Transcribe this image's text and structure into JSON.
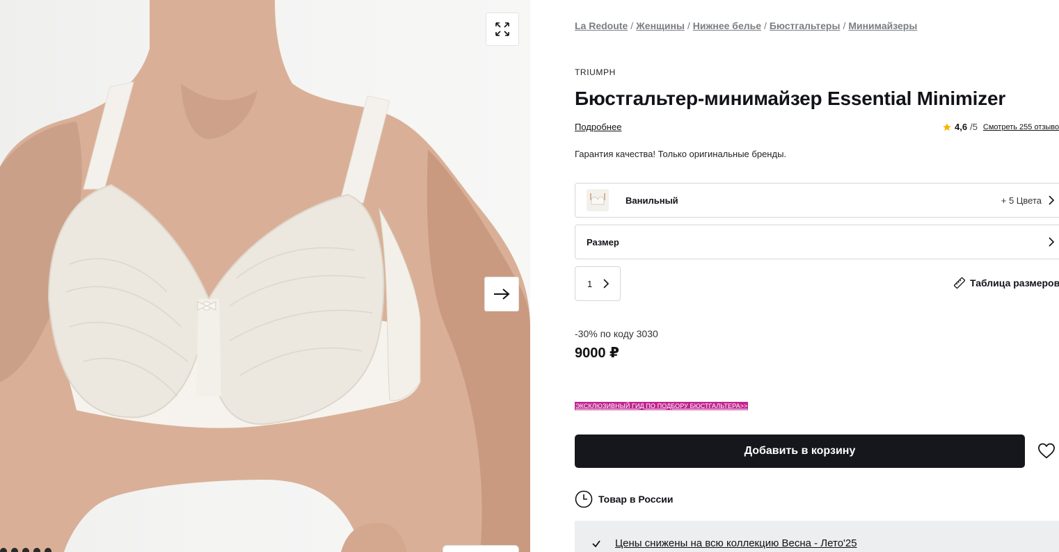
{
  "gallery": {
    "expand_icon": "expand-icon",
    "next_icon": "arrow-right-icon"
  },
  "breadcrumb": [
    "La Redoute",
    "Женщины",
    "Нижнее белье",
    "Бюстгальтеры",
    "Минимайзеры"
  ],
  "product": {
    "brand": "TRIUMPH",
    "title": "Бюстгальтер-минимайзер Essential Minimizer",
    "more_link": "Подробнее",
    "rating_value": "4,6",
    "rating_max": "/5",
    "reviews_link": "Смотреть 255 отзыво",
    "guarantee": "Гарантия качества! Только оригинальные бренды."
  },
  "color_selector": {
    "selected": "Ванильный",
    "more": "+ 5 Цвета"
  },
  "size_selector": {
    "label": "Размер"
  },
  "quantity": {
    "value": "1"
  },
  "size_table_link": "Таблица размеров",
  "price": {
    "promo": "-30% по коду 3030",
    "amount": "9000 ₽"
  },
  "guide_link": "ЭКСКЛЮЗИВНЫЙ ГИД ПО ПОДБОРУ БЮСТГАЛЬТЕРА>>",
  "cart": {
    "add_label": "Добавить в корзину"
  },
  "delivery": {
    "label": "Товар в России"
  },
  "benefits": {
    "line": "Цены снижены на всю коллекцию Весна - Лето'25"
  },
  "colors": {
    "accent_dark": "#15171c",
    "guide_bg": "#c0258f",
    "star": "#f4b400"
  }
}
